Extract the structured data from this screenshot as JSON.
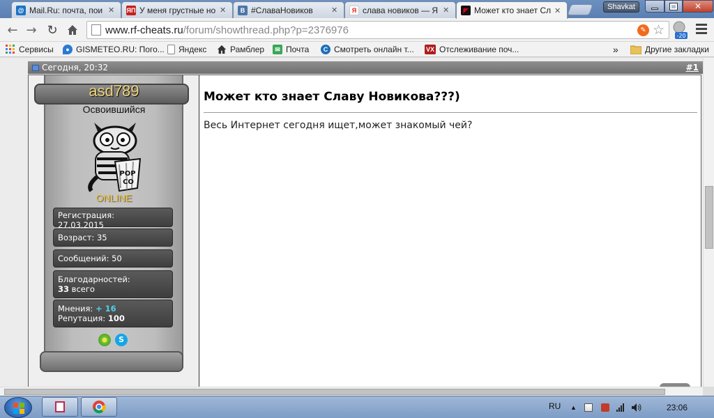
{
  "browser": {
    "tabs": [
      {
        "label": "Mail.Ru: почта, пои",
        "favicon": "mailru-icon",
        "color": "#1a73c6"
      },
      {
        "label": "У меня грустные но",
        "favicon": "yap-icon",
        "color": "#c42020"
      },
      {
        "label": "#СлаваНовиков",
        "favicon": "vk-icon",
        "color": "#4b76a8"
      },
      {
        "label": "слава новиков — Я",
        "favicon": "yandex-icon",
        "color": "#e52620"
      },
      {
        "label": "Может кто знает Сл",
        "favicon": "rf-cheats-icon",
        "color": "#c0001a",
        "active": true
      }
    ],
    "user": "Shavkat",
    "url_host": "www.rf-cheats.ru",
    "url_path": "/forum/showthread.php?p=2376976",
    "bookmarks": [
      {
        "label": "Сервисы",
        "icon": "apps-grid-icon"
      },
      {
        "label": "GISMETEO.RU: Пого...",
        "icon": "gismeteo-icon"
      },
      {
        "label": "Яндекс",
        "icon": "page-icon"
      },
      {
        "label": "Рамблер",
        "icon": "home-icon"
      },
      {
        "label": "Почта",
        "icon": "mail-icon"
      },
      {
        "label": "Смотреть онлайн т...",
        "icon": "tv-icon"
      },
      {
        "label": "Отслеживание поч...",
        "icon": "vx-icon"
      }
    ],
    "bookmarks_overflow": "»",
    "other_bookmarks": "Другие закладки"
  },
  "post": {
    "date": "Сегодня, 20:32",
    "number": "#1",
    "title": "Может кто знает Славу Новикова???)",
    "text": "Весь Интернет сегодня ищет,может знакомый чей?",
    "user": {
      "name": "asd789",
      "rank": "Освоившийся",
      "status": "ONLINE",
      "reg_label": "Регистрация:",
      "reg_date": "27.03.2015",
      "age": "Возраст: 35",
      "messages": "Сообщений: 50",
      "thanks_label": "Благодарностей:",
      "thanks_count": "33",
      "thanks_suffix": " всего",
      "opinions_label": "Мнения: ",
      "opinions_value": "+ 16",
      "reputation_label": "Репутация: ",
      "reputation_value": "100"
    }
  },
  "taskbar": {
    "lang": "RU",
    "time": "23:06"
  }
}
